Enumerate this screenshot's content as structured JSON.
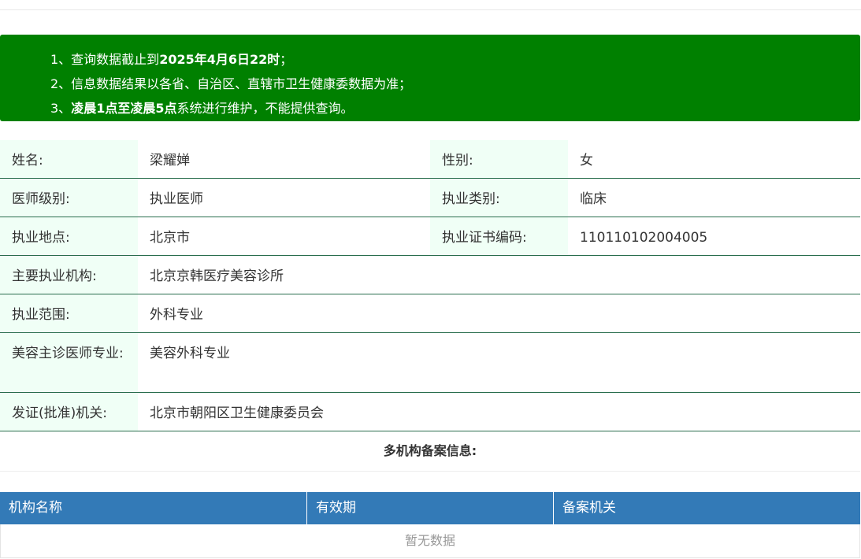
{
  "notice": {
    "line1_prefix": "1、查询数据截止到",
    "line1_bold": "2025年4月6日22时",
    "line1_suffix": "；",
    "line2": "2、信息数据结果以各省、自治区、直辖市卫生健康委数据为准；",
    "line3_prefix": "3、",
    "line3_bold": "凌晨1点至凌晨5点",
    "line3_suffix": "系统进行维护，不能提供查询。"
  },
  "info": {
    "name_label": "姓名:",
    "name_value": "梁耀婵",
    "gender_label": "性别:",
    "gender_value": "女",
    "level_label": "医师级别:",
    "level_value": "执业医师",
    "category_label": "执业类别:",
    "category_value": "临床",
    "location_label": "执业地点:",
    "location_value": "北京市",
    "cert_label": "执业证书编码:",
    "cert_value": "110110102004005",
    "institution_label": "主要执业机构:",
    "institution_value": "北京京韩医疗美容诊所",
    "scope_label": "执业范围:",
    "scope_value": "外科专业",
    "cosmetic_label": "美容主诊医师专业:",
    "cosmetic_value": "美容外科专业",
    "issuer_label": "发证(批准)机关:",
    "issuer_value": "北京市朝阳区卫生健康委员会"
  },
  "multi": {
    "title": "多机构备案信息:"
  },
  "table": {
    "columns": [
      "机构名称",
      "有效期",
      "备案机关"
    ],
    "empty_text": "暂无数据"
  },
  "colors": {
    "notice_bg": "#008000",
    "label_bg": "#f0fff6",
    "row_border": "#2a6e4e",
    "table_header_bg": "#337ab7"
  }
}
